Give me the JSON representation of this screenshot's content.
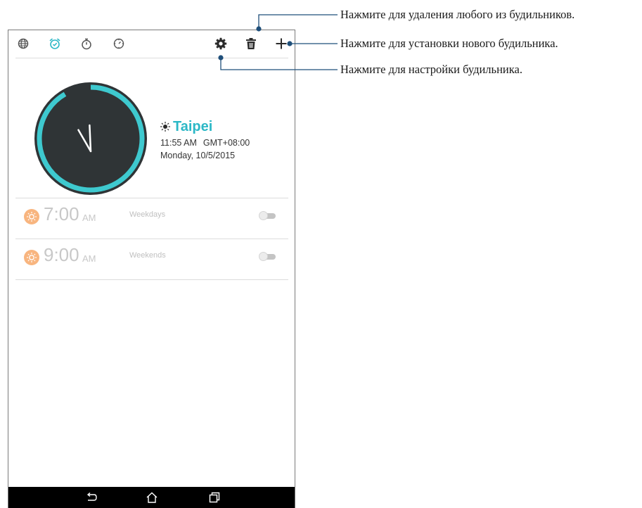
{
  "toolbar": {
    "icons": [
      "world-clock-icon",
      "alarm-icon",
      "stopwatch-icon",
      "timer-icon",
      "settings-icon",
      "delete-icon",
      "add-icon"
    ],
    "active_tab": "alarm",
    "accent_color": "#2cb8c6"
  },
  "clock": {
    "city": "Taipei",
    "time": "11:55 AM",
    "timezone": "GMT+08:00",
    "date": "Monday, 10/5/2015",
    "weather_icon": "sun-icon",
    "hour": 11,
    "minute": 55,
    "ring_color": "#3ec9cf",
    "face_color": "#2f3436"
  },
  "alarms": [
    {
      "time": "7:00",
      "ampm": "AM",
      "repeat": "Weekdays",
      "enabled": false,
      "icon": "sun-icon"
    },
    {
      "time": "9:00",
      "ampm": "AM",
      "repeat": "Weekends",
      "enabled": false,
      "icon": "sun-icon"
    }
  ],
  "navbar": {
    "buttons": [
      "back-icon",
      "home-icon",
      "recents-icon"
    ]
  },
  "callouts": {
    "delete": "Нажмите для удаления любого из будильников.",
    "add": "Нажмите для установки нового будильника.",
    "settings": "Нажмите для настройки будильника."
  }
}
